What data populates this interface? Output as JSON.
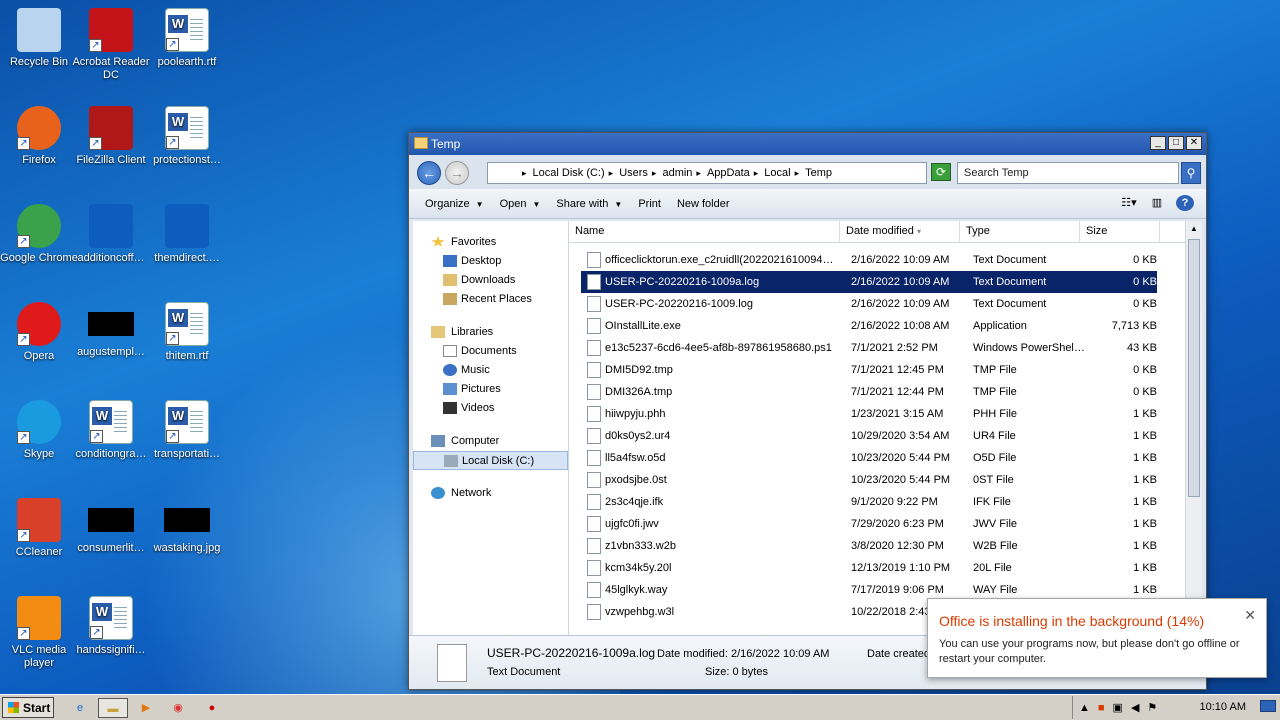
{
  "desktop": {
    "icons": [
      {
        "label": "Recycle Bin",
        "icon": "recycle-bin-icon"
      },
      {
        "label": "Acrobat Reader DC",
        "icon": "acrobat-icon"
      },
      {
        "label": "poolearth.rtf",
        "icon": "word-document-icon"
      },
      {
        "label": "Firefox",
        "icon": "firefox-icon"
      },
      {
        "label": "FileZilla Client",
        "icon": "filezilla-icon"
      },
      {
        "label": "protectionst…",
        "icon": "word-document-icon"
      },
      {
        "label": "Google Chrome",
        "icon": "chrome-icon"
      },
      {
        "label": "additioncoff…",
        "icon": "blank-file-icon"
      },
      {
        "label": "themdirect.…",
        "icon": "blank-file-icon"
      },
      {
        "label": "Opera",
        "icon": "opera-icon"
      },
      {
        "label": "augustempl…",
        "icon": "black-thumbnail-icon"
      },
      {
        "label": "thitem.rtf",
        "icon": "word-document-icon"
      },
      {
        "label": "Skype",
        "icon": "skype-icon"
      },
      {
        "label": "conditiongra…",
        "icon": "word-document-icon"
      },
      {
        "label": "transportati…",
        "icon": "word-document-icon"
      },
      {
        "label": "CCleaner",
        "icon": "ccleaner-icon"
      },
      {
        "label": "consumerlit…",
        "icon": "black-thumbnail-icon"
      },
      {
        "label": "wastaking.jpg",
        "icon": "black-thumbnail-icon"
      },
      {
        "label": "VLC media player",
        "icon": "vlc-icon"
      },
      {
        "label": "handssignifi…",
        "icon": "word-document-icon"
      }
    ]
  },
  "window": {
    "title": "Temp",
    "address": [
      "Local Disk (C:)",
      "Users",
      "admin",
      "AppData",
      "Local",
      "Temp"
    ],
    "search_placeholder": "Search Temp",
    "toolbar": {
      "organize": "Organize",
      "open": "Open",
      "share": "Share with",
      "print": "Print",
      "new_folder": "New folder"
    },
    "nav": {
      "favorites": "Favorites",
      "desktop": "Desktop",
      "downloads": "Downloads",
      "recent": "Recent Places",
      "libraries": "Libraries",
      "documents": "Documents",
      "music": "Music",
      "pictures": "Pictures",
      "videos": "Videos",
      "computer": "Computer",
      "local_disk": "Local Disk (C:)",
      "network": "Network"
    },
    "columns": {
      "name": "Name",
      "date": "Date modified",
      "type": "Type",
      "size": "Size"
    },
    "files": [
      {
        "name": "officeclicktorun.exe_c2ruidll(2022021610094…",
        "date": "2/16/2022 10:09 AM",
        "type": "Text Document",
        "size": "0 KB"
      },
      {
        "name": "USER-PC-20220216-1009a.log",
        "date": "2/16/2022 10:09 AM",
        "type": "Text Document",
        "size": "0 KB"
      },
      {
        "name": "USER-PC-20220216-1009.log",
        "date": "2/16/2022 10:09 AM",
        "type": "Text Document",
        "size": "0 KB"
      },
      {
        "name": "OInstallLite.exe",
        "date": "2/16/2022 10:08 AM",
        "type": "Application",
        "size": "7,713 KB"
      },
      {
        "name": "e13c5237-6cd6-4ee5-af8b-897861958680.ps1",
        "date": "7/1/2021 2:52 PM",
        "type": "Windows PowerShel…",
        "size": "43 KB"
      },
      {
        "name": "DMI5D92.tmp",
        "date": "7/1/2021 12:45 PM",
        "type": "TMP File",
        "size": "0 KB"
      },
      {
        "name": "DMI326A.tmp",
        "date": "7/1/2021 12:44 PM",
        "type": "TMP File",
        "size": "0 KB"
      },
      {
        "name": "hiiwpyju.phh",
        "date": "1/23/2021 3:15 AM",
        "type": "PHH File",
        "size": "1 KB"
      },
      {
        "name": "d0ks0ys2.ur4",
        "date": "10/29/2020 3:54 AM",
        "type": "UR4 File",
        "size": "1 KB"
      },
      {
        "name": "ll5a4fsw.o5d",
        "date": "10/23/2020 5:44 PM",
        "type": "O5D File",
        "size": "1 KB"
      },
      {
        "name": "pxodsjbe.0st",
        "date": "10/23/2020 5:44 PM",
        "type": "0ST File",
        "size": "1 KB"
      },
      {
        "name": "2s3c4qje.ifk",
        "date": "9/1/2020 9:22 PM",
        "type": "IFK File",
        "size": "1 KB"
      },
      {
        "name": "ujgfc0fi.jwv",
        "date": "7/29/2020 6:23 PM",
        "type": "JWV File",
        "size": "1 KB"
      },
      {
        "name": "z1vbn333.w2b",
        "date": "3/8/2020 12:30 PM",
        "type": "W2B File",
        "size": "1 KB"
      },
      {
        "name": "kcm34k5y.20l",
        "date": "12/13/2019 1:10 PM",
        "type": "20L File",
        "size": "1 KB"
      },
      {
        "name": "45lglkyk.way",
        "date": "7/17/2019 9:06 PM",
        "type": "WAY File",
        "size": "1 KB"
      },
      {
        "name": "vzwpehbg.w3l",
        "date": "10/22/2018 2:43",
        "type": "",
        "size": ""
      }
    ],
    "details": {
      "filename": "USER-PC-20220216-1009a.log",
      "filetype": "Text Document",
      "date_modified": "Date modified: 2/16/2022 10:09 AM",
      "size": "Size: 0 bytes",
      "date_created": "Date created"
    }
  },
  "toast": {
    "title": "Office is installing in the background (14%)",
    "progress_percent": 14,
    "body": "You can use your programs now, but please don't go offline or restart your computer."
  },
  "taskbar": {
    "start": "Start",
    "clock": "10:10 AM"
  }
}
